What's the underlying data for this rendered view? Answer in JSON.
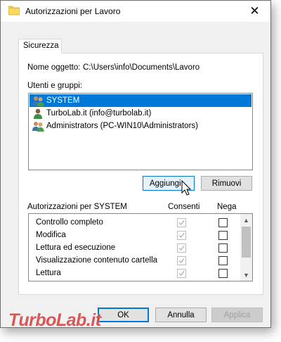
{
  "window": {
    "title": "Autorizzazioni per Lavoro",
    "close_glyph": "✕"
  },
  "tabs": [
    {
      "label": "Sicurezza",
      "active": true
    }
  ],
  "object": {
    "label": "Nome oggetto:",
    "value": "C:\\Users\\info\\Documents\\Lavoro"
  },
  "groups": {
    "label": "Utenti e gruppi:",
    "items": [
      {
        "name": "SYSTEM",
        "icon": "users-group-icon",
        "selected": true
      },
      {
        "name": "TurboLab.it (info@turbolab.it)",
        "icon": "user-icon",
        "selected": false
      },
      {
        "name": "Administrators (PC-WIN10\\Administrators)",
        "icon": "users-group-icon",
        "selected": false
      }
    ],
    "add_button": "Aggiungi...",
    "remove_button": "Rimuovi"
  },
  "permissions": {
    "header": "Autorizzazioni per SYSTEM",
    "allow_col": "Consenti",
    "deny_col": "Nega",
    "rows": [
      {
        "name": "Controllo completo",
        "allow": true,
        "deny": false
      },
      {
        "name": "Modifica",
        "allow": true,
        "deny": false
      },
      {
        "name": "Lettura ed esecuzione",
        "allow": true,
        "deny": false
      },
      {
        "name": "Visualizzazione contenuto cartella",
        "allow": true,
        "deny": false
      },
      {
        "name": "Lettura",
        "allow": true,
        "deny": false
      }
    ]
  },
  "footer": {
    "ok": "OK",
    "cancel": "Annulla",
    "apply": "Applica"
  },
  "watermark": "TurboLab.it",
  "colors": {
    "selection": "#0078d7",
    "watermark": "#cc2020"
  }
}
